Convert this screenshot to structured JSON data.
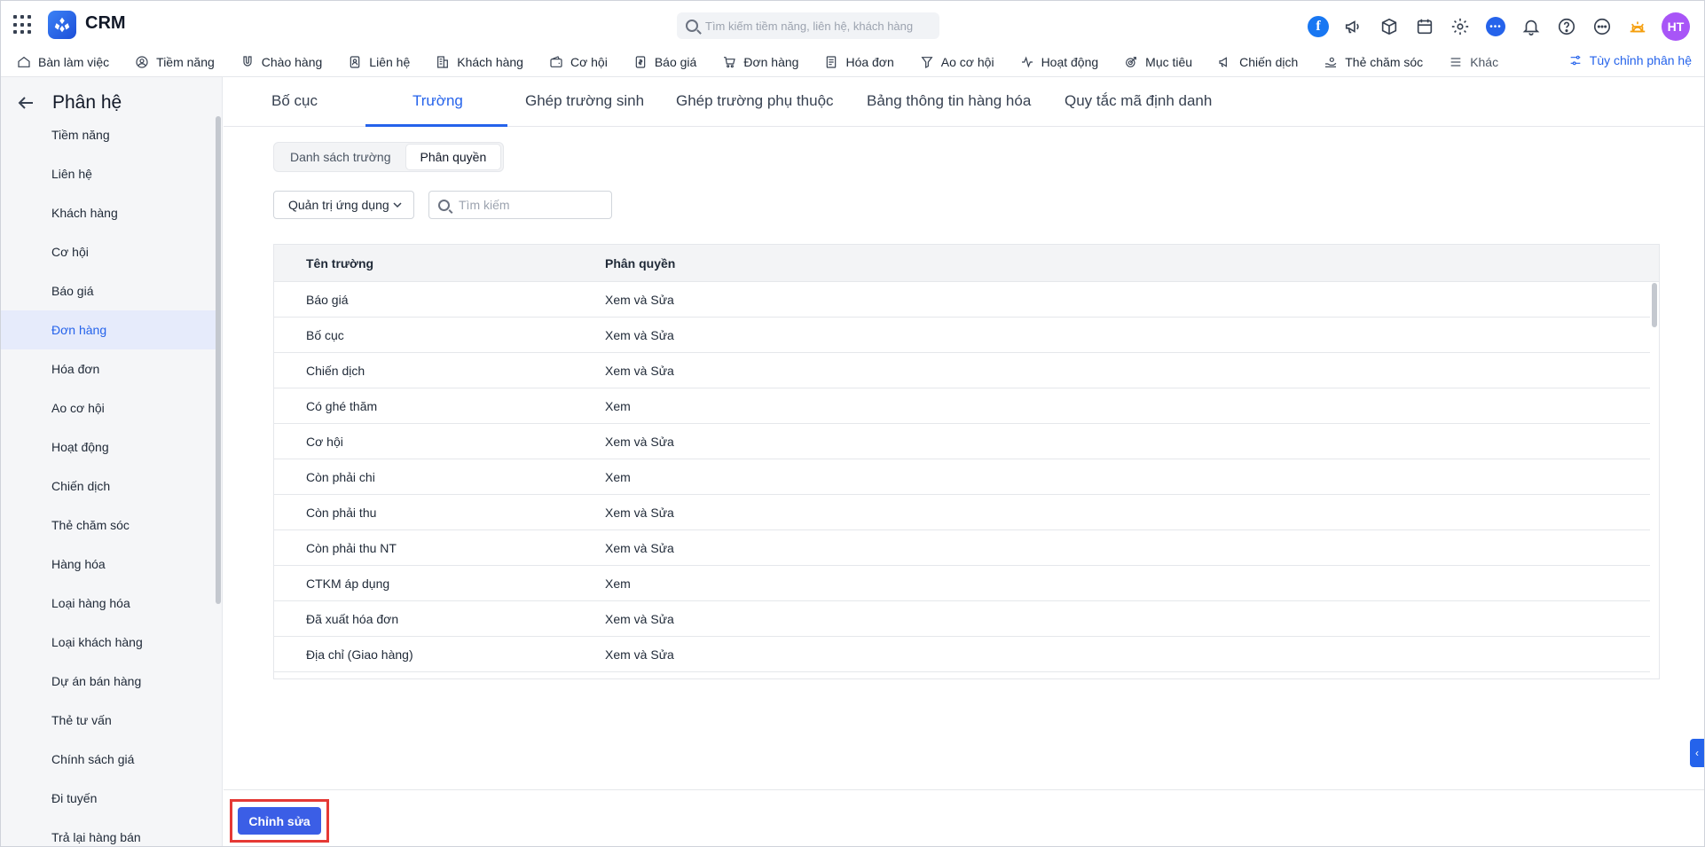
{
  "app": {
    "title": "CRM"
  },
  "search": {
    "placeholder": "Tìm kiếm tiềm năng, liên hệ, khách hàng"
  },
  "user": {
    "initials": "HT",
    "avatar_color": "#a855f7"
  },
  "colors": {
    "accent": "#2563eb",
    "button": "#3b5ee6",
    "highlight": "#e53935"
  },
  "top_icons": [
    "facebook-icon",
    "megaphone-icon",
    "box-icon",
    "calendar-icon",
    "gear-icon",
    "chat-icon",
    "bell-icon",
    "help-icon",
    "more-icon",
    "sun-icon"
  ],
  "nav": {
    "items": [
      {
        "label": "Bàn làm việc",
        "icon": "home-icon"
      },
      {
        "label": "Tiềm năng",
        "icon": "user-circle-icon"
      },
      {
        "label": "Chào hàng",
        "icon": "magnet-icon"
      },
      {
        "label": "Liên hệ",
        "icon": "contact-icon"
      },
      {
        "label": "Khách hàng",
        "icon": "building-icon"
      },
      {
        "label": "Cơ hội",
        "icon": "wallet-icon"
      },
      {
        "label": "Báo giá",
        "icon": "quote-doc-icon"
      },
      {
        "label": "Đơn hàng",
        "icon": "cart-icon"
      },
      {
        "label": "Hóa đơn",
        "icon": "invoice-icon"
      },
      {
        "label": "Ao cơ hội",
        "icon": "funnel-icon"
      },
      {
        "label": "Hoạt động",
        "icon": "activity-icon"
      },
      {
        "label": "Mục tiêu",
        "icon": "target-icon"
      },
      {
        "label": "Chiến dịch",
        "icon": "campaign-icon"
      },
      {
        "label": "Thẻ chăm sóc",
        "icon": "care-icon"
      }
    ],
    "more_label": "Khác",
    "customize_label": "Tùy chỉnh phân hệ"
  },
  "sidebar": {
    "title": "Phân hệ",
    "items": [
      {
        "label": "Tiềm năng"
      },
      {
        "label": "Liên hệ"
      },
      {
        "label": "Khách hàng"
      },
      {
        "label": "Cơ hội"
      },
      {
        "label": "Báo giá"
      },
      {
        "label": "Đơn hàng",
        "active": true
      },
      {
        "label": "Hóa đơn"
      },
      {
        "label": "Ao cơ hội"
      },
      {
        "label": "Hoạt động"
      },
      {
        "label": "Chiến dịch"
      },
      {
        "label": "Thẻ chăm sóc"
      },
      {
        "label": "Hàng hóa"
      },
      {
        "label": "Loại hàng hóa"
      },
      {
        "label": "Loại khách hàng"
      },
      {
        "label": "Dự án bán hàng"
      },
      {
        "label": "Thẻ tư vấn"
      },
      {
        "label": "Chính sách giá"
      },
      {
        "label": "Đi tuyến"
      },
      {
        "label": "Trả lại hàng bán"
      }
    ]
  },
  "tabs": [
    {
      "label": "Bố cục"
    },
    {
      "label": "Trường",
      "active": true
    },
    {
      "label": "Ghép trường sinh"
    },
    {
      "label": "Ghép trường phụ thuộc"
    },
    {
      "label": "Bảng thông tin hàng hóa"
    },
    {
      "label": "Quy tắc mã định danh"
    }
  ],
  "subtabs": [
    {
      "label": "Danh sách trường"
    },
    {
      "label": "Phân quyền",
      "active": true
    }
  ],
  "filter": {
    "role_value": "Quản trị ứng dụng",
    "search_placeholder": "Tìm kiếm"
  },
  "table": {
    "headers": {
      "name": "Tên trường",
      "permission": "Phân quyền"
    },
    "rows": [
      {
        "name": "Báo giá",
        "permission": "Xem và Sửa"
      },
      {
        "name": "Bố cục",
        "permission": "Xem và Sửa"
      },
      {
        "name": "Chiến dịch",
        "permission": "Xem và Sửa"
      },
      {
        "name": "Có ghé thăm",
        "permission": "Xem"
      },
      {
        "name": "Cơ hội",
        "permission": "Xem và Sửa"
      },
      {
        "name": "Còn phải chi",
        "permission": "Xem"
      },
      {
        "name": "Còn phải thu",
        "permission": "Xem và Sửa"
      },
      {
        "name": "Còn phải thu NT",
        "permission": "Xem và Sửa"
      },
      {
        "name": "CTKM áp dụng",
        "permission": "Xem"
      },
      {
        "name": "Đã xuất hóa đơn",
        "permission": "Xem và Sửa"
      },
      {
        "name": "Địa chỉ (Giao hàng)",
        "permission": "Xem và Sửa"
      }
    ]
  },
  "footer": {
    "edit_label": "Chỉnh sửa"
  }
}
